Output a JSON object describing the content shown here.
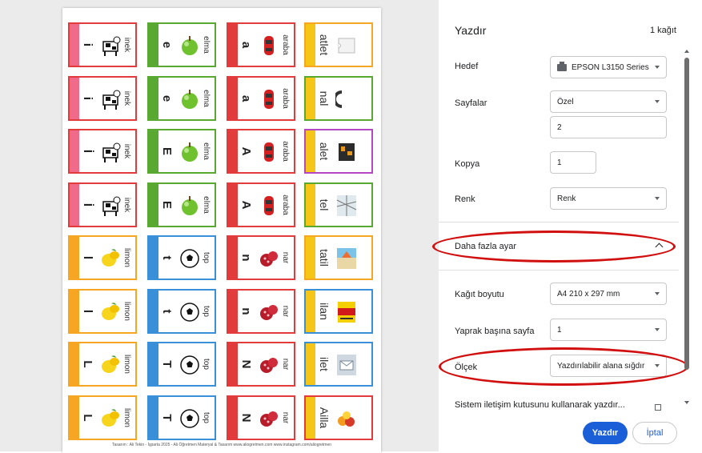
{
  "colors": {
    "red": "#e23b3b",
    "green": "#59a832",
    "pink": "#f06b8a",
    "orange": "#f7a623",
    "blue": "#3a8fd9",
    "yellow": "#f5c518",
    "purple": "#b448c2",
    "accent": "#1a5ed8",
    "annotation": "#d10f0f"
  },
  "preview": {
    "footer": "Tasarım : Ali Tekin - İşparta 2025 -    Ali Öğretmen Materyal & Tasarım    www.aliogretmen.com    www.instagram.com/aliogretmen",
    "cards": [
      {
        "letter": "i",
        "word": "inek",
        "pic": "cow",
        "stripe": "#f06b8a",
        "border": "#e23b3b"
      },
      {
        "letter": "e",
        "word": "elma",
        "pic": "apple",
        "stripe": "#59a832",
        "border": "#59a832"
      },
      {
        "letter": "a",
        "word": "araba",
        "pic": "car",
        "stripe": "#e23b3b",
        "border": "#e23b3b"
      },
      {
        "letter": "",
        "word": "atlet",
        "pic": "shirt",
        "stripe": "#f5c518",
        "border": "#f7a623",
        "big": true
      },
      {
        "letter": "i",
        "word": "inek",
        "pic": "cow",
        "stripe": "#f06b8a",
        "border": "#e23b3b"
      },
      {
        "letter": "e",
        "word": "elma",
        "pic": "apple",
        "stripe": "#59a832",
        "border": "#59a832"
      },
      {
        "letter": "a",
        "word": "araba",
        "pic": "car",
        "stripe": "#e23b3b",
        "border": "#e23b3b"
      },
      {
        "letter": "",
        "word": "nal",
        "pic": "horseshoe",
        "stripe": "#f5c518",
        "border": "#59a832",
        "big": true
      },
      {
        "letter": "İ",
        "word": "inek",
        "pic": "cow",
        "stripe": "#f06b8a",
        "border": "#e23b3b"
      },
      {
        "letter": "E",
        "word": "elma",
        "pic": "apple",
        "stripe": "#59a832",
        "border": "#59a832"
      },
      {
        "letter": "A",
        "word": "araba",
        "pic": "car",
        "stripe": "#e23b3b",
        "border": "#e23b3b"
      },
      {
        "letter": "",
        "word": "alet",
        "pic": "toolbox",
        "stripe": "#f5c518",
        "border": "#b448c2",
        "big": true
      },
      {
        "letter": "İ",
        "word": "inek",
        "pic": "cow",
        "stripe": "#f06b8a",
        "border": "#e23b3b"
      },
      {
        "letter": "E",
        "word": "elma",
        "pic": "apple",
        "stripe": "#59a832",
        "border": "#59a832"
      },
      {
        "letter": "A",
        "word": "araba",
        "pic": "car",
        "stripe": "#e23b3b",
        "border": "#e23b3b"
      },
      {
        "letter": "",
        "word": "tel",
        "pic": "wire",
        "stripe": "#f5c518",
        "border": "#59a832",
        "big": true
      },
      {
        "letter": "l",
        "word": "limon",
        "pic": "lemon",
        "stripe": "#f7a623",
        "border": "#f7a623"
      },
      {
        "letter": "t",
        "word": "top",
        "pic": "ball",
        "stripe": "#3a8fd9",
        "border": "#3a8fd9"
      },
      {
        "letter": "n",
        "word": "nar",
        "pic": "pomegranate",
        "stripe": "#e23b3b",
        "border": "#e23b3b"
      },
      {
        "letter": "",
        "word": "tatil",
        "pic": "beach",
        "stripe": "#f5c518",
        "border": "#f7a623",
        "big": true
      },
      {
        "letter": "l",
        "word": "limon",
        "pic": "lemon",
        "stripe": "#f7a623",
        "border": "#f7a623"
      },
      {
        "letter": "t",
        "word": "top",
        "pic": "ball",
        "stripe": "#3a8fd9",
        "border": "#3a8fd9"
      },
      {
        "letter": "n",
        "word": "nar",
        "pic": "pomegranate",
        "stripe": "#e23b3b",
        "border": "#e23b3b"
      },
      {
        "letter": "",
        "word": "ilan",
        "pic": "sign",
        "stripe": "#f5c518",
        "border": "#3a8fd9",
        "big": true
      },
      {
        "letter": "L",
        "word": "limon",
        "pic": "lemon",
        "stripe": "#f7a623",
        "border": "#f7a623"
      },
      {
        "letter": "T",
        "word": "top",
        "pic": "ball",
        "stripe": "#3a8fd9",
        "border": "#3a8fd9"
      },
      {
        "letter": "N",
        "word": "nar",
        "pic": "pomegranate",
        "stripe": "#e23b3b",
        "border": "#e23b3b"
      },
      {
        "letter": "",
        "word": "ilet",
        "pic": "mail",
        "stripe": "#f5c518",
        "border": "#3a8fd9",
        "big": true
      },
      {
        "letter": "L",
        "word": "limon",
        "pic": "lemon",
        "stripe": "#f7a623",
        "border": "#f7a623"
      },
      {
        "letter": "T",
        "word": "top",
        "pic": "ball",
        "stripe": "#3a8fd9",
        "border": "#3a8fd9"
      },
      {
        "letter": "N",
        "word": "nar",
        "pic": "pomegranate",
        "stripe": "#e23b3b",
        "border": "#e23b3b"
      },
      {
        "letter": "",
        "word": "Ailla",
        "pic": "fruits",
        "stripe": "#f5c518",
        "border": "#e23b3b",
        "big": true
      }
    ]
  },
  "panel": {
    "title": "Yazdır",
    "sheet_count": "1 kağıt",
    "destination": {
      "label": "Hedef",
      "value": "EPSON L3150 Series",
      "icon": "printer-icon"
    },
    "pages": {
      "label": "Sayfalar",
      "value": "Özel",
      "custom": "2"
    },
    "copies": {
      "label": "Kopya",
      "value": "1"
    },
    "color": {
      "label": "Renk",
      "value": "Renk"
    },
    "more_settings": {
      "label": "Daha fazla ayar",
      "icon": "chevron-up-icon"
    },
    "paper_size": {
      "label": "Kağıt boyutu",
      "value": "A4 210 x 297 mm"
    },
    "pages_per_sheet": {
      "label": "Yaprak başına sayfa",
      "value": "1"
    },
    "scale": {
      "label": "Ölçek",
      "value": "Yazdırılabilir alana sığdır"
    },
    "system_dialog": {
      "label": "Sistem iletişim kutusunu kullanarak yazdır...",
      "icon": "open-external-icon"
    },
    "print_button": "Yazdır",
    "cancel_button": "İptal"
  }
}
